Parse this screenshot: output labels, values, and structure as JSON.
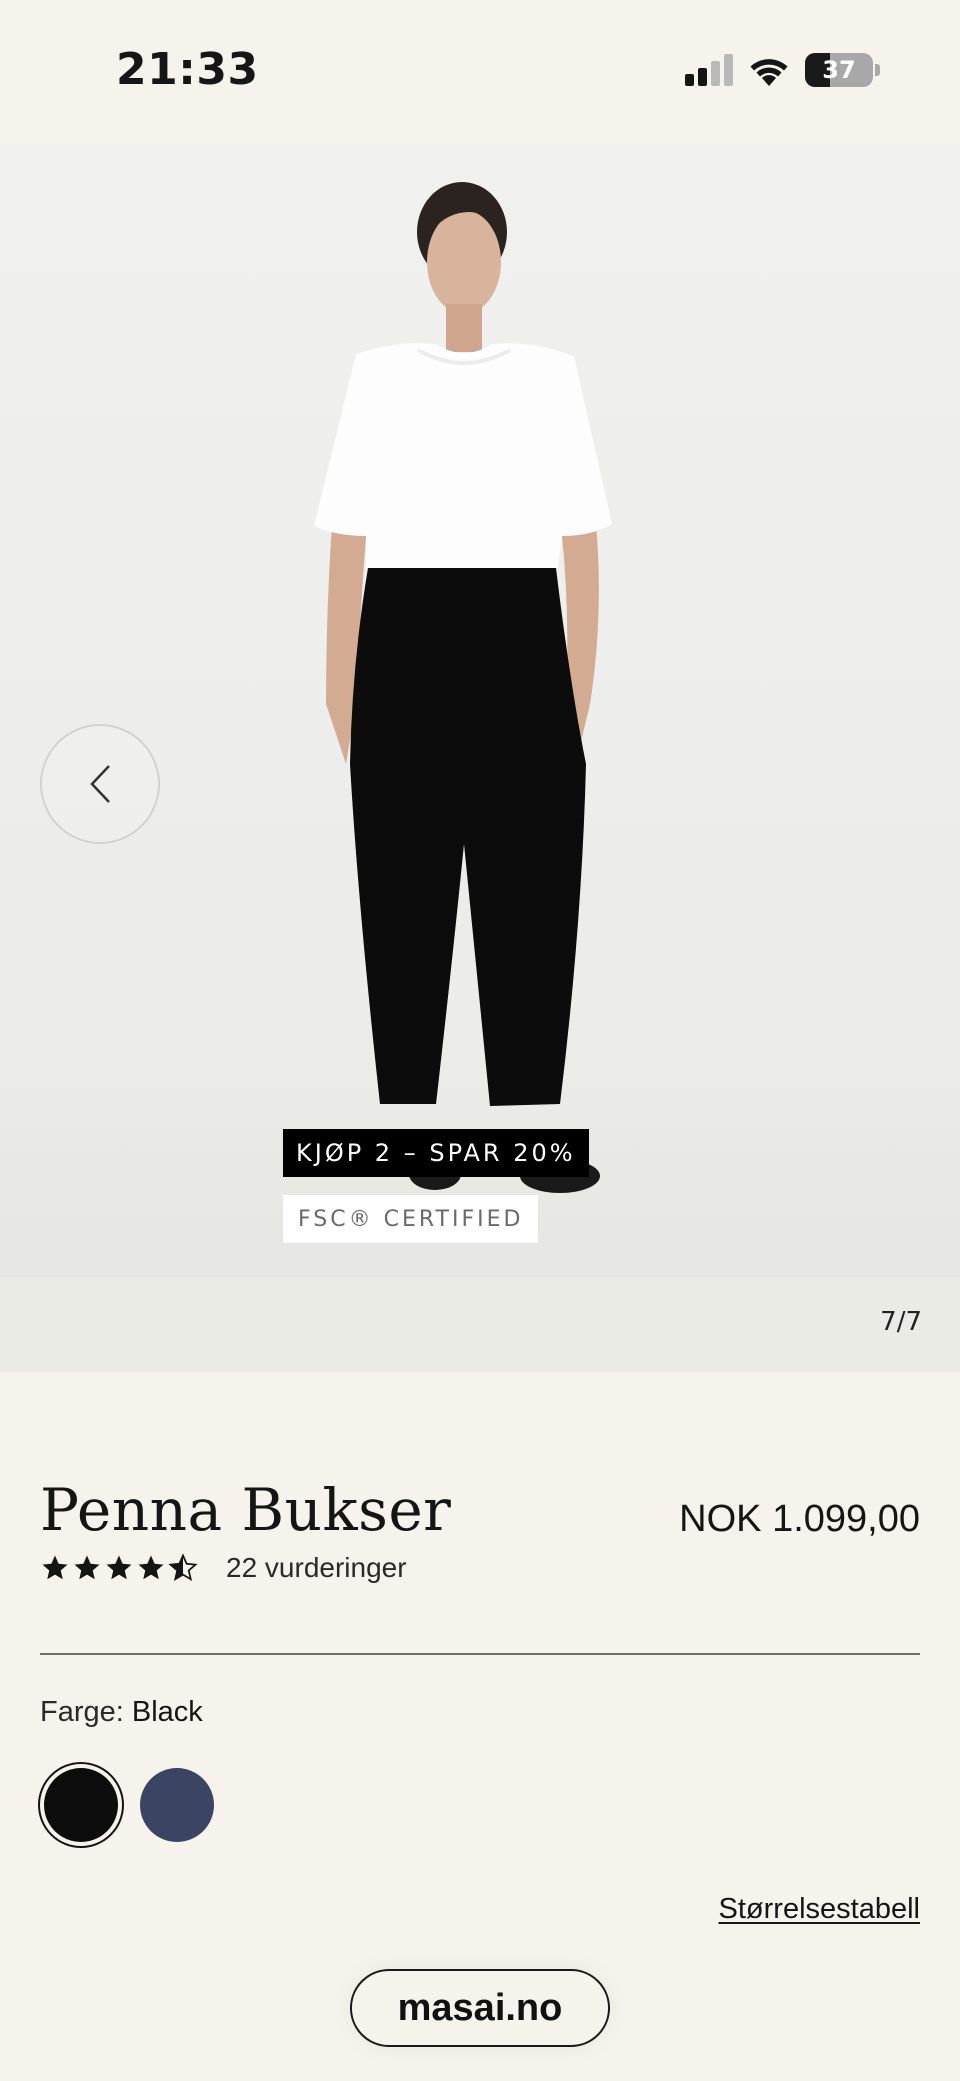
{
  "status_bar": {
    "time": "21:33",
    "battery": "37",
    "battery_level": 0.37,
    "icons": [
      "signal-icon",
      "wifi-icon",
      "battery-icon"
    ]
  },
  "gallery": {
    "promo_badge": "KJØP 2 – SPAR 20%",
    "fsc_badge": "FSC® CERTIFIED",
    "counter": "7/7",
    "prev_icon": "chevron-left-icon"
  },
  "product": {
    "title": "Penna Bukser",
    "price": "NOK 1.099,00",
    "rating": 4.5,
    "review_count": "22 vurderinger",
    "color_label": "Farge:",
    "color_value": "Black",
    "swatches": [
      {
        "name": "Black",
        "color": "#0d0d0d",
        "selected": true
      },
      {
        "name": "Navy",
        "color": "#3b4563",
        "selected": false
      }
    ],
    "size_chart_link": "Størrelsestabell"
  },
  "browser": {
    "url": "masai.no"
  },
  "colors": {
    "background": "#f6f3ec",
    "promo_badge_bg": "#000000",
    "text": "#151515"
  }
}
